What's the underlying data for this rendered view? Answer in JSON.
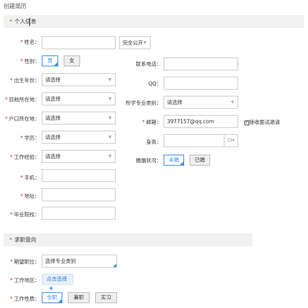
{
  "page": {
    "title": "创建简历"
  },
  "sections": {
    "personal": "个人信息",
    "intent": "求职意向"
  },
  "fields": {
    "name": {
      "label": "姓名：",
      "value": "",
      "visibility": "完全公开"
    },
    "gender": {
      "label": "性别：",
      "options": [
        "男",
        "女"
      ],
      "selected": "男"
    },
    "birth": {
      "label": "出生年份：",
      "value": "请选择"
    },
    "location": {
      "label": "目前所在地：",
      "value": "请选择"
    },
    "hukou": {
      "label": "户口所在地：",
      "value": "请选择"
    },
    "education": {
      "label": "学历：",
      "value": "请选择"
    },
    "experience": {
      "label": "工作经验：",
      "value": "请选择"
    },
    "mobile": {
      "label": "手机：",
      "value": ""
    },
    "address": {
      "label": "地址：",
      "value": ""
    },
    "school": {
      "label": "毕业院校：",
      "value": ""
    },
    "phone": {
      "label": "联系电话：",
      "value": ""
    },
    "qq": {
      "label": "QQ：",
      "value": ""
    },
    "major": {
      "label": "所学专业类别：",
      "value": "请选择"
    },
    "email": {
      "label": "邮箱：",
      "value": "3977157@qq.com",
      "invite_label": "接收面试邀请",
      "invite_checked": true
    },
    "height": {
      "label": "身高：",
      "value": "",
      "unit": "CM"
    },
    "marital": {
      "label": "婚姻状况：",
      "options": [
        "未婚",
        "已婚"
      ],
      "selected": "未婚"
    },
    "position": {
      "label": "期望职位：",
      "value": "选择专业类别"
    },
    "work_area": {
      "label": "工作地区：",
      "button": "点击选择",
      "plus": "+"
    },
    "work_type": {
      "label": "工作性质：",
      "options": [
        "全职",
        "兼职",
        "实习"
      ],
      "selected": "全职"
    }
  },
  "colors": {
    "accent": "#3a8ee6",
    "required": "#d9302e",
    "section_bg": "#f1f1f1"
  }
}
